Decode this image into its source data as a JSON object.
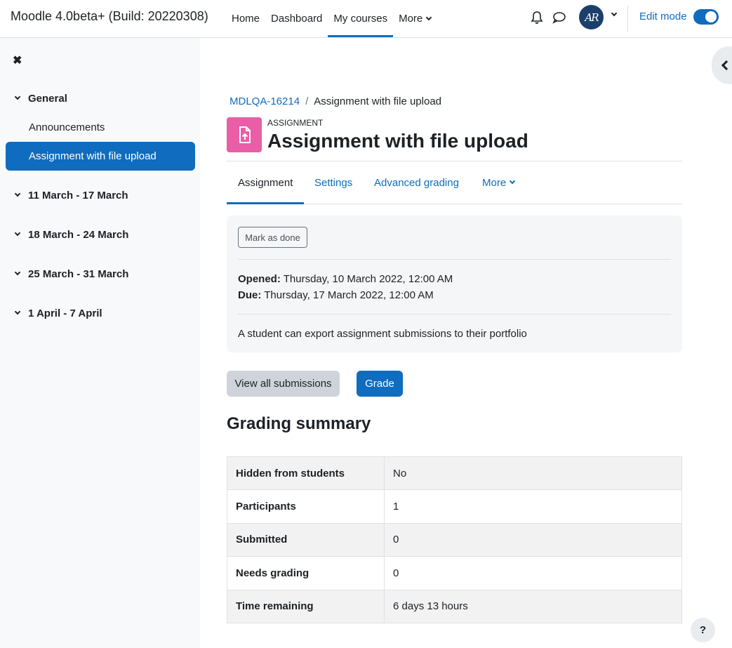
{
  "site": {
    "brand": "Moodle 4.0beta+ (Build: 20220308)"
  },
  "primary_nav": {
    "home": "Home",
    "dashboard": "Dashboard",
    "my_courses": "My courses",
    "more": "More"
  },
  "user": {
    "initials": "AR",
    "edit_mode_label": "Edit mode",
    "edit_mode_on": true
  },
  "drawer": {
    "close": "✖",
    "general": "General",
    "announcements": "Announcements",
    "active_item": "Assignment with file upload",
    "sections": [
      "11 March - 17 March",
      "18 March - 24 March",
      "25 March - 31 March",
      "1 April - 7 April"
    ]
  },
  "breadcrumb": {
    "course": "MDLQA-16214",
    "separator": "/",
    "current": "Assignment with file upload"
  },
  "activity": {
    "module_label": "ASSIGNMENT",
    "title": "Assignment with file upload",
    "icon_color": "#e95ea6"
  },
  "secondary_nav": {
    "assignment": "Assignment",
    "settings": "Settings",
    "advanced_grading": "Advanced grading",
    "more": "More"
  },
  "details": {
    "mark_done": "Mark as done",
    "opened_label": "Opened:",
    "opened_value": "Thursday, 10 March 2022, 12:00 AM",
    "due_label": "Due:",
    "due_value": "Thursday, 17 March 2022, 12:00 AM",
    "description": "A student can export assignment submissions to their portfolio"
  },
  "actions": {
    "view_all": "View all submissions",
    "grade": "Grade"
  },
  "grading_summary": {
    "heading": "Grading summary",
    "rows": [
      {
        "label": "Hidden from students",
        "value": "No"
      },
      {
        "label": "Participants",
        "value": "1"
      },
      {
        "label": "Submitted",
        "value": "0"
      },
      {
        "label": "Needs grading",
        "value": "0"
      },
      {
        "label": "Time remaining",
        "value": "6 days 13 hours"
      }
    ]
  },
  "help": "?",
  "colors": {
    "primary": "#0f6cbf",
    "drawer_bg": "#f8f9fa"
  }
}
